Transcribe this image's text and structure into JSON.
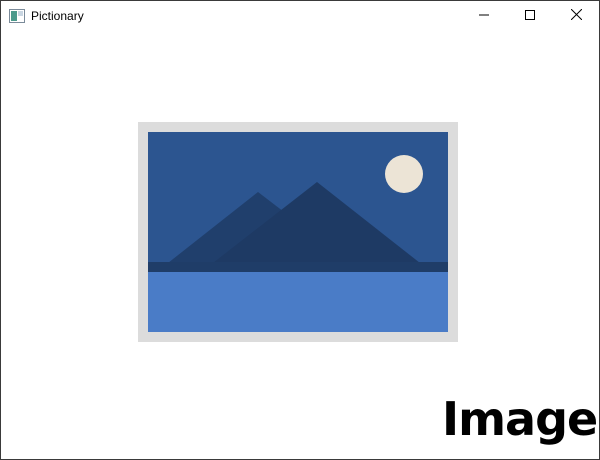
{
  "window": {
    "title": "Pictionary",
    "icons": {
      "app": "image-app-icon",
      "minimize": "minimize-icon",
      "maximize": "maximize-icon",
      "close": "close-icon"
    }
  },
  "content": {
    "picture_icon": "landscape-image-icon",
    "caption": "Image"
  },
  "colors": {
    "frame": "#dcdcdc",
    "sky": "#2c5590",
    "mountain": "#1e3a64",
    "water": "#4a7cc7",
    "moon": "#ece4d6"
  }
}
